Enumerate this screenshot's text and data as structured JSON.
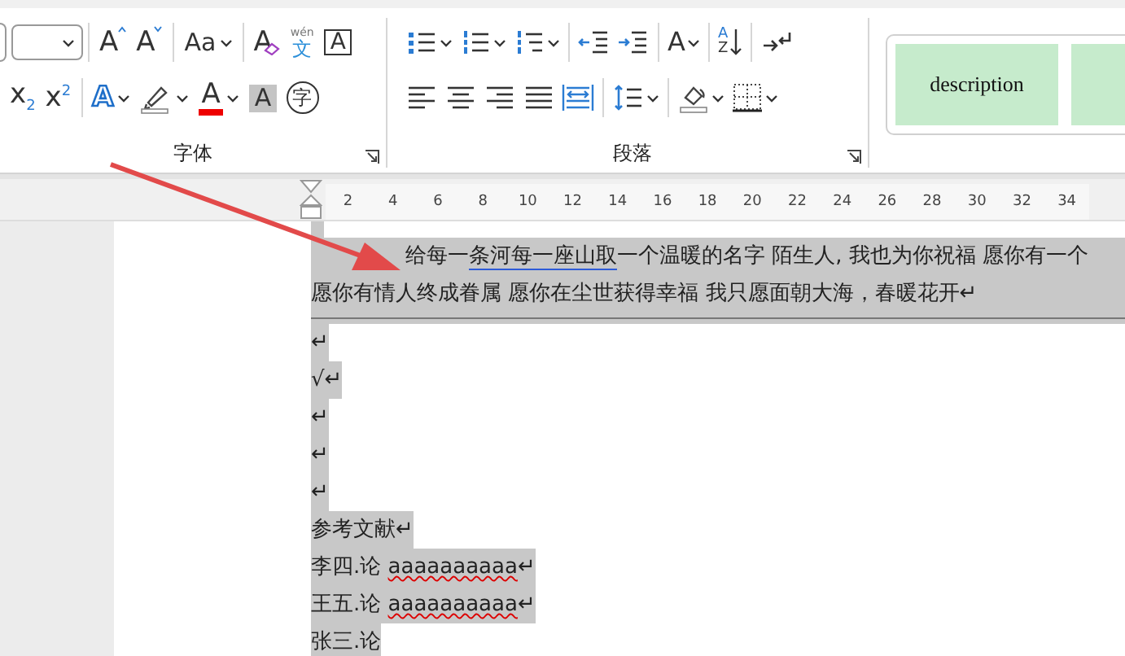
{
  "ribbon": {
    "font_group": {
      "label": "字体",
      "rows": [
        [
          [
            {
              "kind": "size-field"
            }
          ],
          [
            {
              "kind": "grow",
              "glyph": "A"
            },
            {
              "kind": "shrink",
              "glyph": "A"
            }
          ],
          [
            {
              "kind": "case",
              "glyph": "Aa",
              "dropdown": true
            }
          ],
          [
            {
              "kind": "clear",
              "glyph": "A"
            },
            {
              "kind": "phonetic",
              "glyph": "文",
              "ruby": "wén"
            },
            {
              "kind": "border",
              "glyph": "A"
            }
          ]
        ],
        [
          [
            {
              "kind": "subscript",
              "glyph": "x",
              "index": "2"
            },
            {
              "kind": "superscript",
              "glyph": "x",
              "index": "2"
            }
          ],
          [
            {
              "kind": "effects",
              "glyph": "A",
              "dropdown": true
            },
            {
              "kind": "highlight",
              "dropdown": true
            },
            {
              "kind": "color",
              "glyph": "A",
              "dropdown": true
            },
            {
              "kind": "shade",
              "glyph": "A"
            },
            {
              "kind": "enclose",
              "glyph": "字"
            }
          ]
        ]
      ]
    },
    "paragraph_group": {
      "label": "段落",
      "rows": [
        [
          [
            {
              "kind": "bullets",
              "dropdown": true
            },
            {
              "kind": "numbering",
              "dropdown": true
            },
            {
              "kind": "multilevel",
              "dropdown": true
            }
          ],
          [
            {
              "kind": "outdent"
            },
            {
              "kind": "indent"
            }
          ],
          [
            {
              "kind": "layout",
              "glyph": "A",
              "dropdown": true
            }
          ],
          [
            {
              "kind": "sort",
              "glyph": "A",
              "index": "Z"
            }
          ],
          [
            {
              "kind": "marks"
            }
          ]
        ],
        [
          [
            {
              "kind": "align-left"
            },
            {
              "kind": "align-center"
            },
            {
              "kind": "align-right"
            },
            {
              "kind": "justify"
            },
            {
              "kind": "distribute"
            }
          ],
          [
            {
              "kind": "spacing",
              "dropdown": true
            }
          ],
          [
            {
              "kind": "shading",
              "dropdown": true
            },
            {
              "kind": "borders",
              "dropdown": true
            }
          ]
        ]
      ]
    },
    "styles": [
      {
        "label": "description"
      }
    ]
  },
  "ruler": {
    "ticks": [
      "2",
      "4",
      "6",
      "8",
      "10",
      "12",
      "14",
      "16",
      "18",
      "20",
      "22",
      "24",
      "26",
      "28",
      "30",
      "32",
      "34"
    ]
  },
  "document": {
    "paragraphs": [
      {
        "kind": "body",
        "segments": [
          {
            "text": "给每一",
            "underlined": false,
            "misspelled": false
          },
          {
            "text": "条河每一座山取",
            "underlined": true,
            "misspelled": false
          },
          {
            "text": "一个温暖的名字  陌生人, 我也为你祝福  愿你有一个",
            "underlined": false,
            "misspelled": false
          }
        ]
      },
      {
        "kind": "wrap",
        "segments": [
          {
            "text": "愿你有情人终成眷属  愿你在尘世获得幸福  我只愿面朝大海，春暖花开↵",
            "underlined": false,
            "misspelled": false
          }
        ]
      },
      {
        "kind": "rule"
      },
      {
        "kind": "line",
        "segments": [
          {
            "text": "↵",
            "underlined": false,
            "misspelled": false
          }
        ]
      },
      {
        "kind": "line",
        "segments": [
          {
            "text": " √↵",
            "underlined": false,
            "misspelled": false
          }
        ]
      },
      {
        "kind": "line",
        "segments": [
          {
            "text": "↵",
            "underlined": false,
            "misspelled": false
          }
        ]
      },
      {
        "kind": "line",
        "segments": [
          {
            "text": "↵",
            "underlined": false,
            "misspelled": false
          }
        ]
      },
      {
        "kind": "line",
        "segments": [
          {
            "text": "↵",
            "underlined": false,
            "misspelled": false
          }
        ]
      },
      {
        "kind": "line",
        "segments": [
          {
            "text": "参考文献↵",
            "underlined": false,
            "misspelled": false
          }
        ]
      },
      {
        "kind": "line",
        "segments": [
          {
            "text": "李四.论 ",
            "underlined": false,
            "misspelled": false
          },
          {
            "text": "aaaaaaaaaa",
            "underlined": false,
            "misspelled": true
          },
          {
            "text": "↵",
            "underlined": false,
            "misspelled": false
          }
        ]
      },
      {
        "kind": "line",
        "segments": [
          {
            "text": "王五.论 ",
            "underlined": false,
            "misspelled": false
          },
          {
            "text": "aaaaaaaaaa",
            "underlined": false,
            "misspelled": true
          },
          {
            "text": "↵",
            "underlined": false,
            "misspelled": false
          }
        ]
      },
      {
        "kind": "line",
        "segments": [
          {
            "text": "张三.论",
            "underlined": false,
            "misspelled": false
          }
        ]
      }
    ]
  }
}
